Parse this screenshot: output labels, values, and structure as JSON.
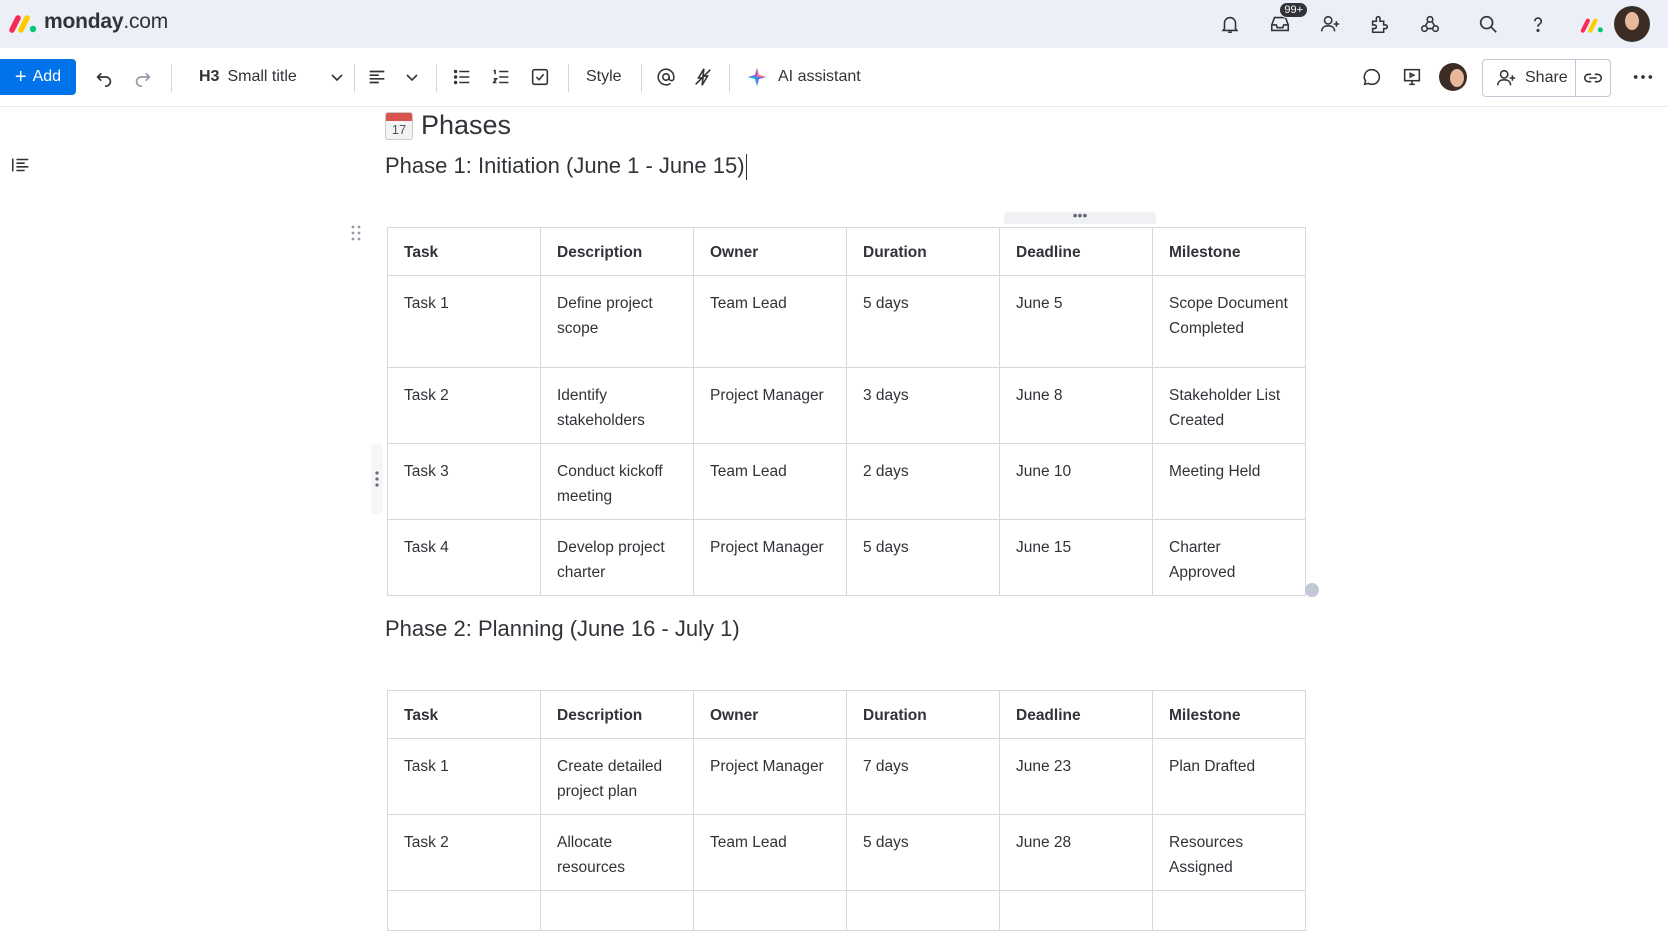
{
  "app": {
    "logo_text_bold": "monday",
    "logo_text_rest": ".com",
    "notifications_badge": "99+"
  },
  "toolbar": {
    "add_label": "Add",
    "heading_tag": "H3",
    "heading_style": "Small title",
    "style_label": "Style",
    "ai_label": "AI assistant",
    "share_label": "Share"
  },
  "doc": {
    "section_icon_day": "17",
    "section_title": "Phases",
    "phase1_title": "Phase 1: Initiation (June 1 - June 15)",
    "phase2_title": "Phase 2: Planning (June 16 - July 1)",
    "columns": [
      "Task",
      "Description",
      "Owner",
      "Duration",
      "Deadline",
      "Milestone"
    ],
    "phase1_rows": [
      [
        "Task 1",
        "Define project scope",
        "Team Lead",
        "5 days",
        "June 5",
        "Scope Document Completed"
      ],
      [
        "Task 2",
        "Identify stakeholders",
        "Project Manager",
        "3 days",
        "June 8",
        "Stakeholder List Created"
      ],
      [
        "Task 3",
        "Conduct kickoff meeting",
        "Team Lead",
        "2 days",
        "June 10",
        "Meeting Held"
      ],
      [
        "Task 4",
        "Develop project charter",
        "Project Manager",
        "5 days",
        "June 15",
        "Charter Approved"
      ]
    ],
    "phase2_rows": [
      [
        "Task 1",
        "Create detailed project plan",
        "Project Manager",
        "7 days",
        "June 23",
        "Plan Drafted"
      ],
      [
        "Task 2",
        "Allocate resources",
        "Team Lead",
        "5 days",
        "June 28",
        "Resources Assigned"
      ],
      [
        "",
        "",
        "",
        "",
        "",
        ""
      ]
    ]
  }
}
